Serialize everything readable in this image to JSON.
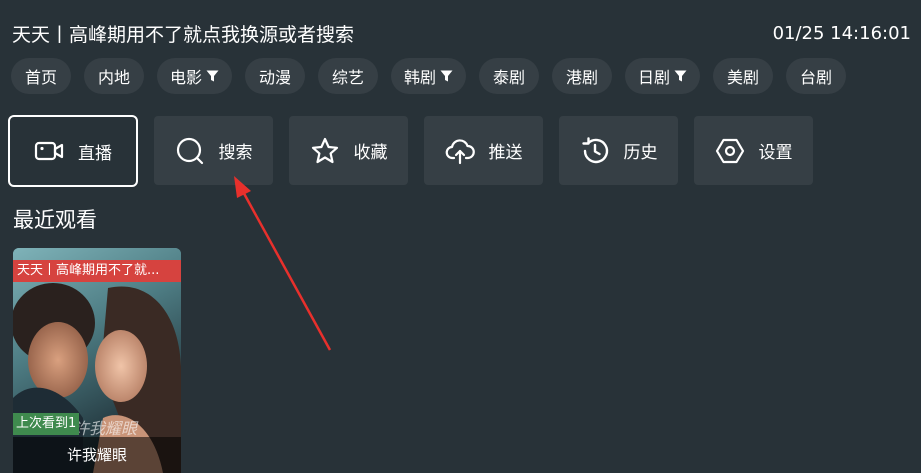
{
  "header": {
    "title": "天天丨高峰期用不了就点我换源或者搜索",
    "datetime": "01/25 14:16:01"
  },
  "categories": [
    {
      "label": "首页",
      "filter": false,
      "active": true
    },
    {
      "label": "内地",
      "filter": false
    },
    {
      "label": "电影",
      "filter": true
    },
    {
      "label": "动漫",
      "filter": false
    },
    {
      "label": "综艺",
      "filter": false
    },
    {
      "label": "韩剧",
      "filter": true
    },
    {
      "label": "泰剧",
      "filter": false
    },
    {
      "label": "港剧",
      "filter": false
    },
    {
      "label": "日剧",
      "filter": true
    },
    {
      "label": "美剧",
      "filter": false
    },
    {
      "label": "台剧",
      "filter": false
    }
  ],
  "actions": [
    {
      "label": "直播",
      "icon": "video-camera-icon",
      "selected": true
    },
    {
      "label": "搜索",
      "icon": "search-icon"
    },
    {
      "label": "收藏",
      "icon": "star-icon"
    },
    {
      "label": "推送",
      "icon": "cloud-upload-icon"
    },
    {
      "label": "历史",
      "icon": "history-icon"
    },
    {
      "label": "设置",
      "icon": "settings-hexagon-icon"
    }
  ],
  "recent": {
    "section_title": "最近观看",
    "items": [
      {
        "source": "天天丨高峰期用不了就...",
        "progress": "上次看到1",
        "title": "许我耀眼"
      }
    ]
  },
  "annotation": {
    "color": "#e8302c"
  }
}
